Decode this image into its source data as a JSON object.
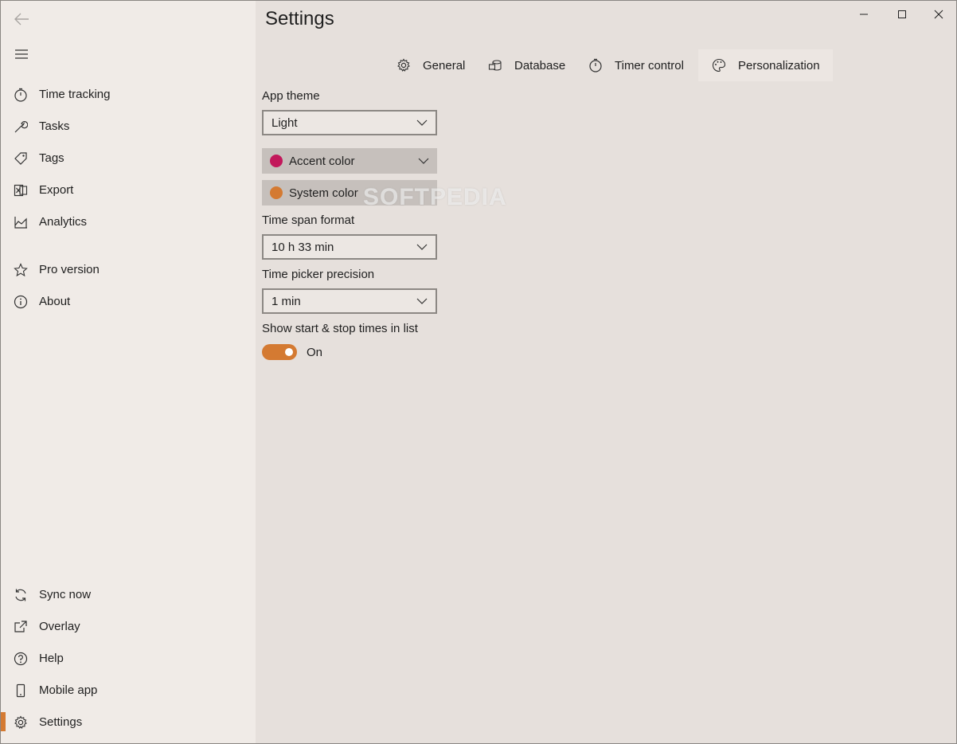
{
  "page_title": "Settings",
  "sidebar": {
    "top_items": [
      {
        "label": "Time tracking",
        "icon": "stopwatch-icon"
      },
      {
        "label": "Tasks",
        "icon": "wrench-icon"
      },
      {
        "label": "Tags",
        "icon": "tag-icon"
      },
      {
        "label": "Export",
        "icon": "excel-icon"
      },
      {
        "label": "Analytics",
        "icon": "area-chart-icon"
      },
      {
        "label": "Pro version",
        "icon": "star-icon"
      },
      {
        "label": "About",
        "icon": "info-icon"
      }
    ],
    "bottom_items": [
      {
        "label": "Sync now",
        "icon": "sync-icon"
      },
      {
        "label": "Overlay",
        "icon": "popout-icon"
      },
      {
        "label": "Help",
        "icon": "help-icon"
      },
      {
        "label": "Mobile app",
        "icon": "phone-icon"
      },
      {
        "label": "Settings",
        "icon": "gear-icon",
        "active": true
      }
    ]
  },
  "tabs": [
    {
      "label": "General",
      "icon": "gear-icon"
    },
    {
      "label": "Database",
      "icon": "database-icon"
    },
    {
      "label": "Timer control",
      "icon": "stopwatch-icon"
    },
    {
      "label": "Personalization",
      "icon": "palette-icon",
      "selected": true
    }
  ],
  "personalization": {
    "app_theme_label": "App theme",
    "app_theme_value": "Light",
    "accent_color_label": "Accent color",
    "accent_color": "#c2185b",
    "system_color_label": "System color",
    "system_color": "#d47a32",
    "time_span_format_label": "Time span format",
    "time_span_format_value": "10 h 33 min",
    "time_picker_precision_label": "Time picker precision",
    "time_picker_precision_value": "1 min",
    "show_times_label": "Show start & stop times in list",
    "show_times_state": "On"
  },
  "watermark": "SOFTPEDIA",
  "colors": {
    "accent": "#d47a32",
    "sidebar_bg": "#f0ebe7",
    "main_bg": "#e6e0dc"
  }
}
